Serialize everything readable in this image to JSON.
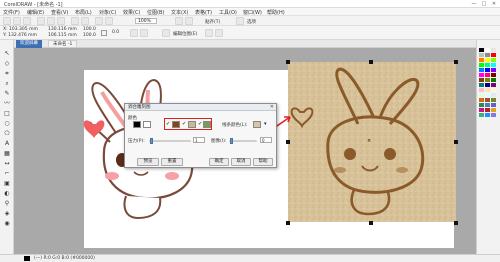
{
  "window": {
    "title": "CorelDRAW - [未命名 -1]",
    "minimize": "—",
    "maximize": "□",
    "close": "✕"
  },
  "menu": [
    "文件(F)",
    "编辑(E)",
    "查看(V)",
    "布局(L)",
    "对象(C)",
    "效果(C)",
    "位图(B)",
    "文本(X)",
    "表格(T)",
    "工具(O)",
    "窗口(W)",
    "帮助(H)"
  ],
  "toolbar": {
    "zoom": "100%",
    "snap_label": "贴齐(T)",
    "options_label": "选项"
  },
  "propbar": {
    "x": "X: 103.305 mm",
    "y": "Y: 132.476 mm",
    "w": "130.116 mm",
    "h": "106.115 mm",
    "sx": "100.0",
    "sy": "100.0",
    "angle": "0.0",
    "edit_bitmap": "编辑位图(E)"
  },
  "tabs": [
    {
      "label": "欢迎屏幕"
    },
    {
      "label": "未命名 -1"
    }
  ],
  "dialog": {
    "title": "调合雕刻图",
    "color_label": "颜色",
    "blend_label": "线条颜色(L):",
    "pressure_label": "压力(P):",
    "pressure_value": "1",
    "detail_label": "图像(I):",
    "detail_value": "0",
    "buttons": {
      "preview": "预览",
      "reset": "重置",
      "ok": "确定",
      "cancel": "取消",
      "help": "帮助"
    },
    "swatch_colors": [
      "#000000",
      "#ffffff",
      "#8b4513",
      "#c8b89a",
      "#7a9a5a",
      "#d8c6a8"
    ]
  },
  "palette_colors": [
    "#000000",
    "#ffffff",
    "#e6e6e6",
    "#bfbfbf",
    "#8c8c8c",
    "#ff0000",
    "#ff8000",
    "#ffff00",
    "#80ff00",
    "#00ff00",
    "#00ff80",
    "#00ffff",
    "#0080ff",
    "#0000ff",
    "#8000ff",
    "#ff00ff",
    "#ff0080",
    "#800000",
    "#804000",
    "#808000",
    "#008000",
    "#008080",
    "#000080",
    "#800080",
    "#ffc0cb",
    "#ffe4b5",
    "#fffacd",
    "#e0ffe0",
    "#e0ffff",
    "#e6e6fa",
    "#d2691e",
    "#a0522d",
    "#6b8e23",
    "#2e8b57",
    "#4682b4",
    "#6a5acd",
    "#c71585",
    "#b22222",
    "#daa520",
    "#3cb371",
    "#1e90ff",
    "#9370db"
  ],
  "statusbar": {
    "text": "(—)  R:0 G:0 B:0 (#000000)"
  }
}
